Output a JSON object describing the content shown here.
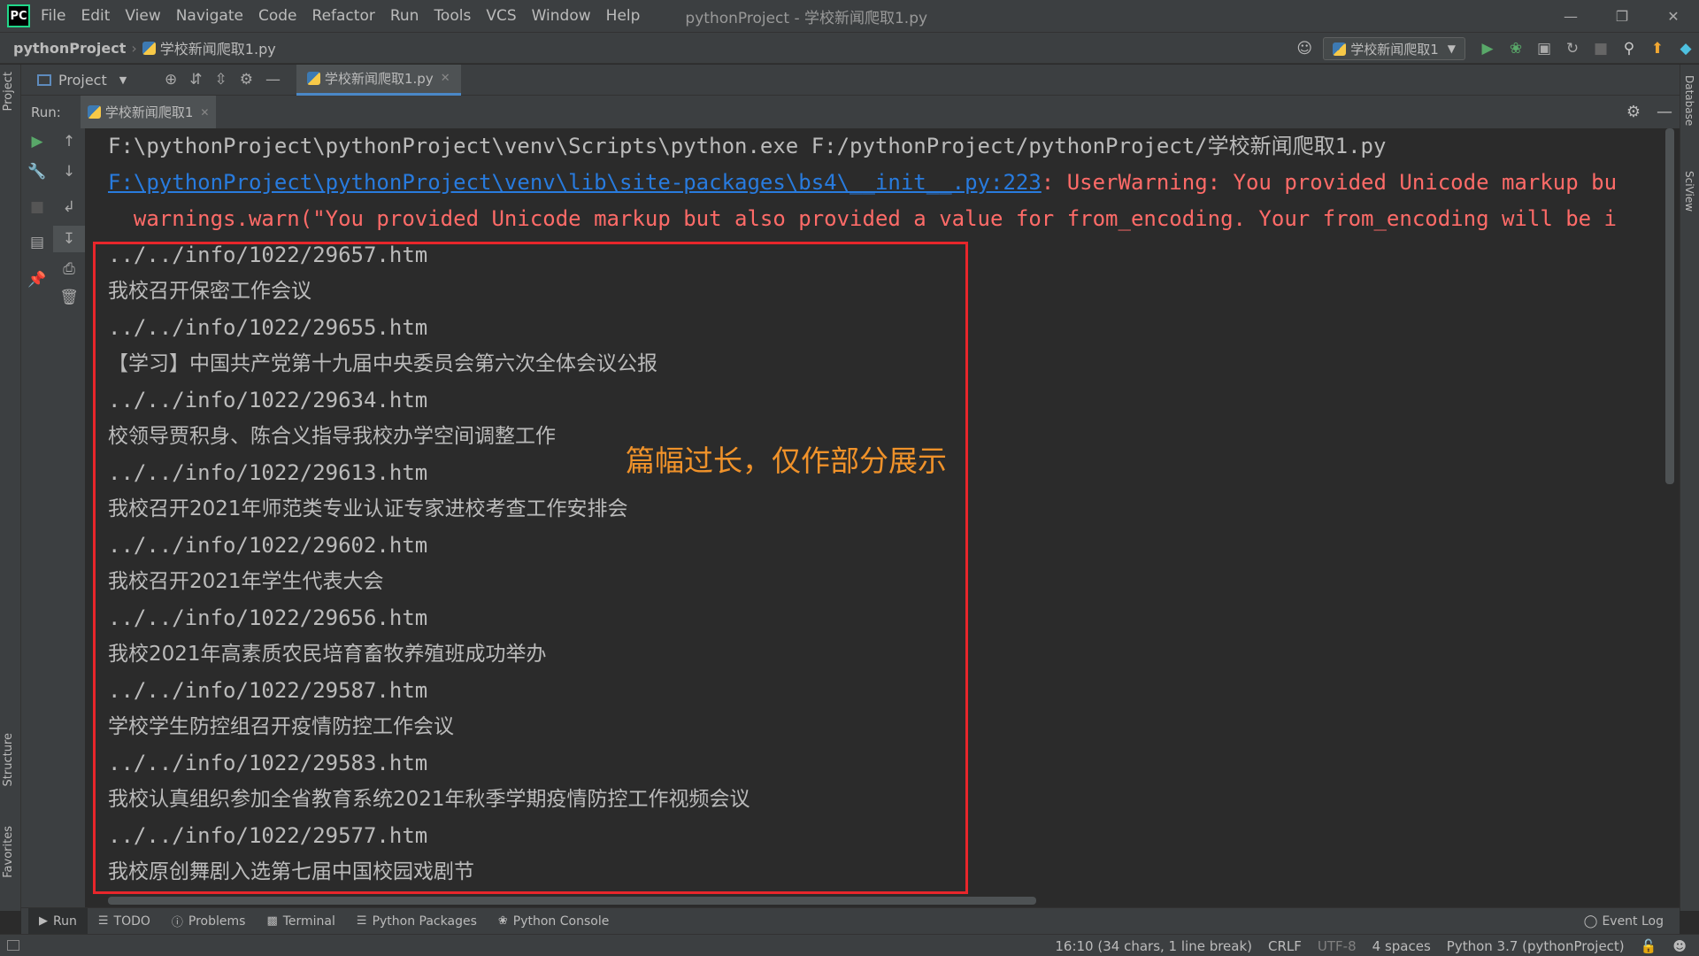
{
  "app": {
    "title": "pythonProject - 学校新闻爬取1.py",
    "logo_text": "PC",
    "menu": [
      "File",
      "Edit",
      "View",
      "Navigate",
      "Code",
      "Refactor",
      "Run",
      "Tools",
      "VCS",
      "Window",
      "Help"
    ]
  },
  "navbar": {
    "project": "pythonProject",
    "file": "学校新闻爬取1.py",
    "run_config": "学校新闻爬取1"
  },
  "tabs": {
    "project_label": "Project",
    "editor_tab": "学校新闻爬取1.py"
  },
  "left_stripe": {
    "project": "Project",
    "structure": "Structure",
    "favorites": "Favorites"
  },
  "right_stripe": {
    "database": "Database",
    "sciview": "SciView"
  },
  "run": {
    "label": "Run:",
    "tab": "学校新闻爬取1"
  },
  "console": {
    "command": "F:\\pythonProject\\pythonProject\\venv\\Scripts\\python.exe F:/pythonProject/pythonProject/学校新闻爬取1.py",
    "warning_link": "F:\\pythonProject\\pythonProject\\venv\\lib\\site-packages\\bs4\\__init__.py:223",
    "warning_text": ": UserWarning: You provided Unicode markup bu",
    "warn_line": "  warnings.warn(\"You provided Unicode markup but also provided a value for from_encoding. Your from_encoding will be i",
    "output": [
      "../../info/1022/29657.htm",
      "我校召开保密工作会议",
      "../../info/1022/29655.htm",
      "【学习】中国共产党第十九届中央委员会第六次全体会议公报",
      "../../info/1022/29634.htm",
      "校领导贾积身、陈合义指导我校办学空间调整工作",
      "../../info/1022/29613.htm",
      "我校召开2021年师范类专业认证专家进校考查工作安排会",
      "../../info/1022/29602.htm",
      "我校召开2021年学生代表大会",
      "../../info/1022/29656.htm",
      "我校2021年高素质农民培育畜牧养殖班成功举办",
      "../../info/1022/29587.htm",
      "学校学生防控组召开疫情防控工作会议",
      "../../info/1022/29583.htm",
      "我校认真组织参加全省教育系统2021年秋季学期疫情防控工作视频会议",
      "../../info/1022/29577.htm",
      "我校原创舞剧入选第七届中国校园戏剧节"
    ],
    "annotation": "篇幅过长，仅作部分展示"
  },
  "bottombar": {
    "items": [
      "Run",
      "TODO",
      "Problems",
      "Terminal",
      "Python Packages",
      "Python Console"
    ],
    "event_log": "Event Log"
  },
  "status": {
    "position": "16:10 (34 chars, 1 line break)",
    "line_sep": "CRLF",
    "encoding": "UTF-8",
    "indent": "4 spaces",
    "interpreter": "Python 3.7 (pythonProject)"
  }
}
